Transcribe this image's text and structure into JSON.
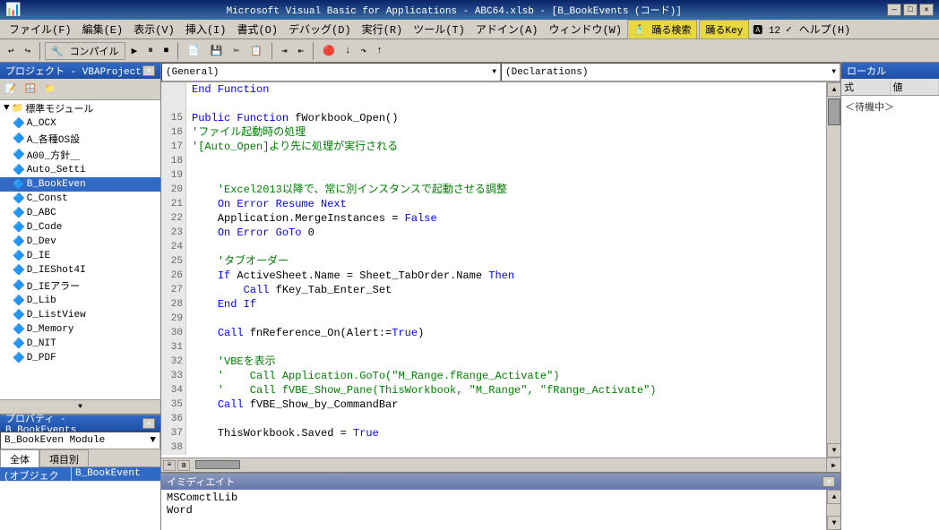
{
  "titleBar": {
    "icon": "📊",
    "title": "Microsoft Visual Basic for Applications - ABC64.xlsb - [B_BookEvents (コード)]",
    "minimize": "—",
    "maximize": "□",
    "close": "✕"
  },
  "menuBar": {
    "items": [
      {
        "label": "ファイル(F)",
        "id": "file"
      },
      {
        "label": "編集(E)",
        "id": "edit"
      },
      {
        "label": "表示(V)",
        "id": "view"
      },
      {
        "label": "挿入(I)",
        "id": "insert"
      },
      {
        "label": "書式(O)",
        "id": "format"
      },
      {
        "label": "デバッグ(D)",
        "id": "debug"
      },
      {
        "label": "実行(R)",
        "id": "run"
      },
      {
        "label": "ツール(T)",
        "id": "tools"
      },
      {
        "label": "アドイン(A)",
        "id": "addin"
      },
      {
        "label": "ウィンドウ(W)",
        "id": "window"
      },
      {
        "label": "踊る検索",
        "id": "search"
      },
      {
        "label": "踊るKey",
        "id": "key"
      },
      {
        "label": "12",
        "id": "num"
      },
      {
        "label": "ヘルプ(H)",
        "id": "help"
      }
    ]
  },
  "toolbar": {
    "compile": "コンパイル",
    "buttons": [
      "▶",
      "⏸",
      "⏹",
      "📄",
      "✂",
      "📋",
      "🔍"
    ]
  },
  "projectPanel": {
    "title": "プロジェクト - VBAProject",
    "treeItems": [
      {
        "label": "標準モジュール",
        "indent": 1,
        "type": "folder"
      },
      {
        "label": "A_OCX",
        "indent": 2,
        "type": "module"
      },
      {
        "label": "A_各種OS設",
        "indent": 2,
        "type": "module"
      },
      {
        "label": "A00_方針＿",
        "indent": 2,
        "type": "module"
      },
      {
        "label": "Auto_Setti",
        "indent": 2,
        "type": "module"
      },
      {
        "label": "B_BookEven",
        "indent": 2,
        "type": "module",
        "selected": true
      },
      {
        "label": "C_Const",
        "indent": 2,
        "type": "module"
      },
      {
        "label": "D_ABC",
        "indent": 2,
        "type": "module"
      },
      {
        "label": "D_Code",
        "indent": 2,
        "type": "module"
      },
      {
        "label": "D_Dev",
        "indent": 2,
        "type": "module"
      },
      {
        "label": "D_IE",
        "indent": 2,
        "type": "module"
      },
      {
        "label": "D_IEShot4I",
        "indent": 2,
        "type": "module"
      },
      {
        "label": "D_IEアラー",
        "indent": 2,
        "type": "module"
      },
      {
        "label": "D_Lib",
        "indent": 2,
        "type": "module"
      },
      {
        "label": "D_ListView",
        "indent": 2,
        "type": "module"
      },
      {
        "label": "D_Memory",
        "indent": 2,
        "type": "module"
      },
      {
        "label": "D_NIT",
        "indent": 2,
        "type": "module"
      },
      {
        "label": "D_PDF",
        "indent": 2,
        "type": "module"
      }
    ]
  },
  "propertiesPanel": {
    "title": "プロパティ - B_BookEvents",
    "dropdown": "B_BookEven Module",
    "tabs": [
      "全体",
      "項目別"
    ],
    "selectedItem": "(オブジェクト名) B_BookEvent"
  },
  "codeDropdowns": {
    "left": "(General)",
    "right": "(Declarations)"
  },
  "codeLines": [
    {
      "num": "",
      "content": "End Function"
    },
    {
      "num": "",
      "content": ""
    },
    {
      "num": "15",
      "content": "<kw-blue>Public Function</kw-blue> fWorkbook_Open()"
    },
    {
      "num": "16",
      "content": "<kw-green>'ファイル起動時の処理</kw-green>"
    },
    {
      "num": "17",
      "content": "<kw-green>'[Auto_Open]より先に処理が実行される</kw-green>"
    },
    {
      "num": "18",
      "content": ""
    },
    {
      "num": "19",
      "content": ""
    },
    {
      "num": "20",
      "content": "    <kw-green>'Excel2013以降で、常に別インスタンスで起動させる調整</kw-green>"
    },
    {
      "num": "21",
      "content": "    <kw-blue>On Error Resume Next</kw-blue>"
    },
    {
      "num": "22",
      "content": "    Application.MergeInstances = <kw-blue>False</kw-blue>"
    },
    {
      "num": "23",
      "content": "    <kw-blue>On Error GoTo</kw-blue> 0"
    },
    {
      "num": "24",
      "content": ""
    },
    {
      "num": "25",
      "content": "    <kw-green>'タブオーダー</kw-green>"
    },
    {
      "num": "26",
      "content": "    <kw-blue>If</kw-blue> ActiveSheet.Name = Sheet_TabOrder.Name <kw-blue>Then</kw-blue>"
    },
    {
      "num": "27",
      "content": "        <kw-blue>Call</kw-blue> fKey_Tab_Enter_Set"
    },
    {
      "num": "28",
      "content": "    <kw-blue>End If</kw-blue>"
    },
    {
      "num": "29",
      "content": ""
    },
    {
      "num": "30",
      "content": "    <kw-blue>Call</kw-blue> fnReference_On(Alert:=<kw-blue>True</kw-blue>)"
    },
    {
      "num": "31",
      "content": ""
    },
    {
      "num": "32",
      "content": "    <kw-green>'VBEを表示</kw-green>"
    },
    {
      "num": "33",
      "content": "    <kw-green>'    Call Application.GoTo(\"M_Range.fRange_Activate\")</kw-green>"
    },
    {
      "num": "34",
      "content": "    <kw-green>'    Call fVBE_Show_Pane(ThisWorkbook, \"M_Range\", \"fRange_Activate\")</kw-green>"
    },
    {
      "num": "35",
      "content": "    <kw-blue>Call</kw-blue> fVBE_Show_by_CommandBar"
    },
    {
      "num": "36",
      "content": ""
    },
    {
      "num": "37",
      "content": "    ThisWorkbook.Saved = <kw-blue>True</kw-blue>"
    },
    {
      "num": "38",
      "content": ""
    }
  ],
  "rightPanel": {
    "title": "ローカル",
    "waitLabel": "＜待機中＞",
    "columns": [
      "式",
      "値"
    ]
  },
  "immediatePanel": {
    "title": "イミディエイト",
    "lines": [
      "MSComctlLib",
      "Word"
    ]
  }
}
